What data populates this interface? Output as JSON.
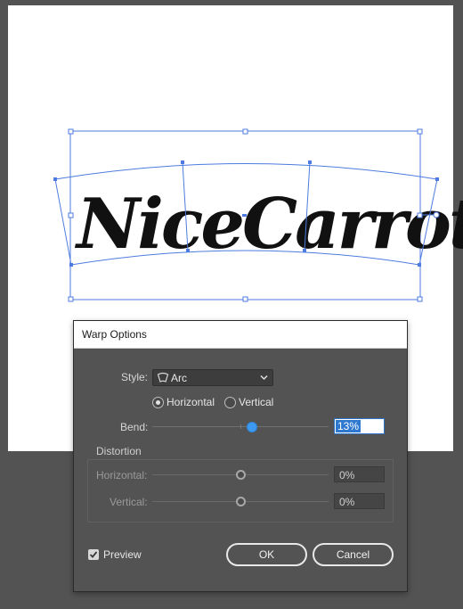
{
  "artwork": {
    "text": "NiceCarrot"
  },
  "dialog": {
    "title": "Warp Options",
    "style": {
      "label": "Style:",
      "value": "Arc",
      "icon": "arc-warp-icon"
    },
    "orientation": {
      "horizontal_label": "Horizontal",
      "vertical_label": "Vertical",
      "selected": "Horizontal"
    },
    "bend": {
      "label": "Bend:",
      "value": "13%",
      "level": 0.13
    },
    "distortion": {
      "title": "Distortion",
      "horizontal": {
        "label": "Horizontal:",
        "value": "0%",
        "level": 0
      },
      "vertical": {
        "label": "Vertical:",
        "value": "0%",
        "level": 0
      }
    },
    "preview": {
      "label": "Preview",
      "checked": true
    },
    "ok_label": "OK",
    "cancel_label": "Cancel"
  },
  "colors": {
    "selection": "#4d7be0",
    "canvas": "#535353",
    "accent": "#3e9af1"
  }
}
